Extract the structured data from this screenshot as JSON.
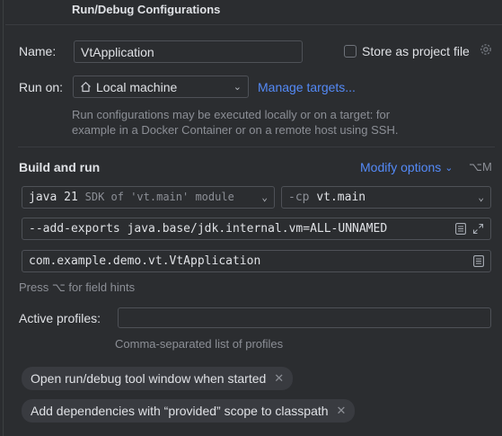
{
  "dialog": {
    "title": "Run/Debug Configurations"
  },
  "name_row": {
    "label": "Name:",
    "value": "VtApplication",
    "store_label": "Store as project file"
  },
  "run_on": {
    "label": "Run on:",
    "value": "Local machine",
    "manage_link": "Manage targets...",
    "hint_line1": "Run configurations may be executed locally or on a target: for",
    "hint_line2": "example in a Docker Container or on a remote host using SSH."
  },
  "build": {
    "title": "Build and run",
    "modify_options": "Modify options",
    "shortcut": "⌥M",
    "sdk_bold": "java 21",
    "sdk_detail": "SDK of 'vt.main' module",
    "cp_flag": "-cp",
    "cp_value": "vt.main",
    "vm_options": "--add-exports java.base/jdk.internal.vm=ALL-UNNAMED",
    "main_class": "com.example.demo.vt.VtApplication",
    "field_hint": "Press ⌥ for field hints"
  },
  "profiles": {
    "label": "Active profiles:",
    "value": "",
    "hint": "Comma-separated list of profiles"
  },
  "chips": [
    {
      "label": "Open run/debug tool window when started"
    },
    {
      "label": "Add dependencies with “provided” scope to classpath"
    }
  ]
}
